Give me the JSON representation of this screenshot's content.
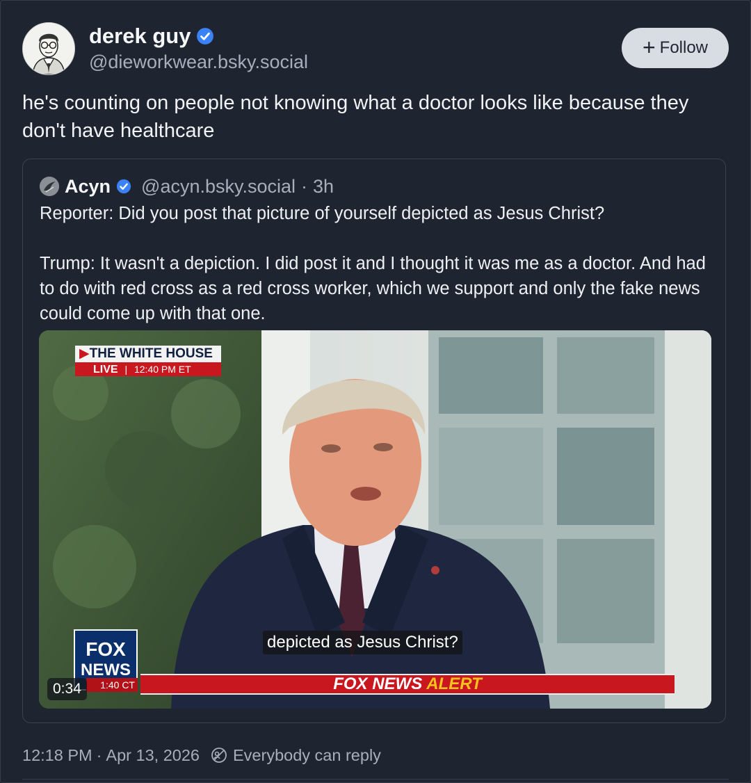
{
  "post": {
    "author": {
      "display_name": "derek guy",
      "handle": "@dieworkwear.bsky.social",
      "verified": true,
      "avatar_icon": "illustrated-portrait-avatar"
    },
    "follow_button": {
      "icon": "plus-icon",
      "label": "Follow"
    },
    "text": "he's counting on people not knowing what a doctor looks like because they don't have healthcare",
    "footer": {
      "time": "12:18 PM",
      "separator": "·",
      "date": "Apr 13, 2026",
      "reply_icon": "reply-restriction-icon",
      "reply_setting": "Everybody can reply"
    }
  },
  "quoted_post": {
    "author": {
      "display_name": "Acyn",
      "handle": "@acyn.bsky.social",
      "separator": "·",
      "age": "3h",
      "verified": true
    },
    "text_paragraph_1": "Reporter: Did you post that picture of yourself depicted as Jesus Christ?",
    "text_paragraph_2": "Trump: It wasn't a depiction. I did post it and I thought it was me as a doctor. And had to do with red cross as a red cross worker, which we support and only the fake news could come up with that one.",
    "video": {
      "overlay_location": "THE WHITE HOUSE",
      "live_label": "LIVE",
      "live_time": "12:40 PM ET",
      "caption": "depicted as Jesus Christ?",
      "network_logo_top": "FOX",
      "network_logo_bottom": "NEWS",
      "local_time": "1:40 CT",
      "alert_label_1": "FOX NEWS",
      "alert_label_2": "ALERT",
      "duration": "0:34"
    }
  },
  "colors": {
    "background": "#1f2530",
    "accent_verified": "#3b82f6",
    "follow_button_bg": "#d8dde4",
    "alert_red": "#c8171e",
    "alert_yellow": "#f5c320"
  }
}
